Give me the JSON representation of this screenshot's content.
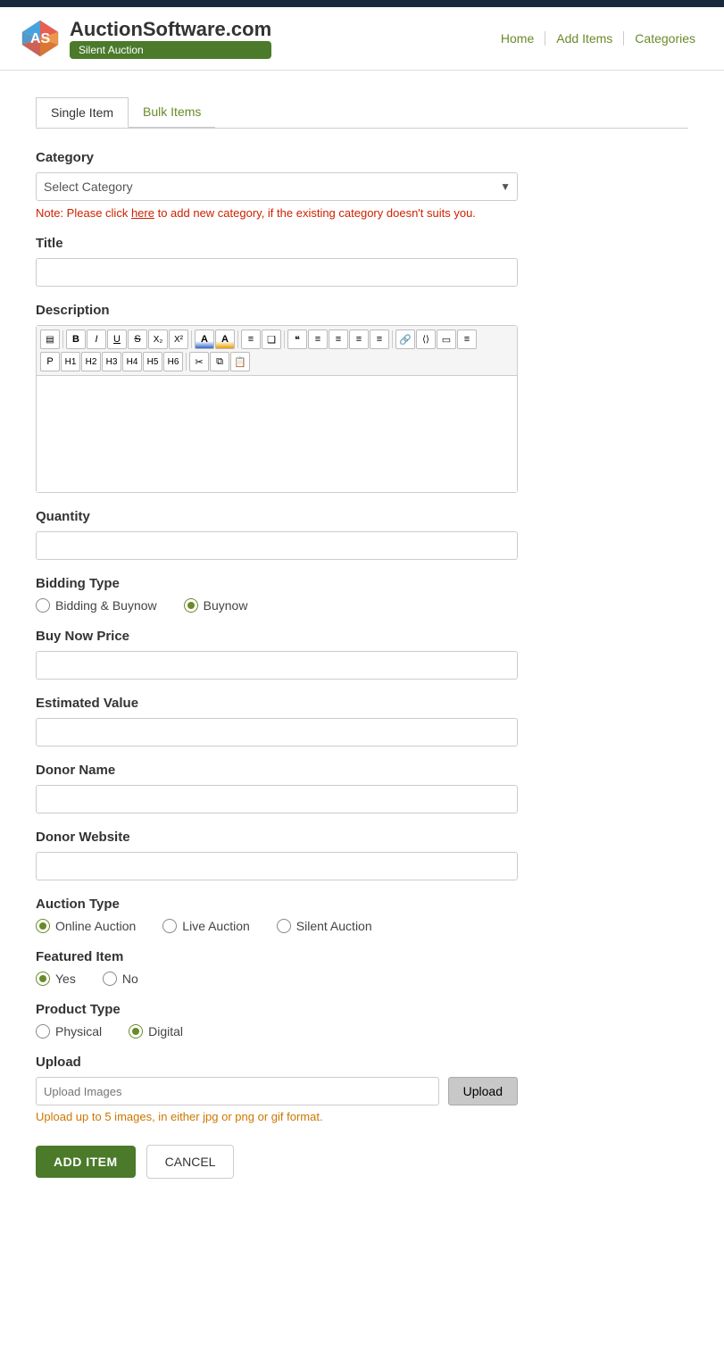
{
  "header": {
    "bar_color": "#1a2a3a"
  },
  "navbar": {
    "brand": "AuctionSoftware.com",
    "badge": "Silent Auction",
    "links": [
      "Home",
      "Add Items",
      "Categories"
    ]
  },
  "tabs": {
    "active": "Single Item",
    "inactive": "Bulk Items"
  },
  "form": {
    "category_label": "Category",
    "category_placeholder": "Select Category",
    "category_note_prefix": "Note: Please click ",
    "category_note_link": "here",
    "category_note_suffix": " to add new category, if the existing category doesn't suits you.",
    "title_label": "Title",
    "description_label": "Description",
    "quantity_label": "Quantity",
    "bidding_type_label": "Bidding Type",
    "bidding_type_options": [
      {
        "id": "bidding-buynow",
        "label": "Bidding & Buynow",
        "checked": false
      },
      {
        "id": "buynow",
        "label": "Buynow",
        "checked": true
      }
    ],
    "buy_now_price_label": "Buy Now Price",
    "estimated_value_label": "Estimated Value",
    "donor_name_label": "Donor Name",
    "donor_website_label": "Donor Website",
    "auction_type_label": "Auction Type",
    "auction_type_options": [
      {
        "id": "online-auction",
        "label": "Online Auction",
        "checked": true
      },
      {
        "id": "live-auction",
        "label": "Live Auction",
        "checked": false
      },
      {
        "id": "silent-auction",
        "label": "Silent Auction",
        "checked": false
      }
    ],
    "featured_item_label": "Featured Item",
    "featured_item_options": [
      {
        "id": "yes",
        "label": "Yes",
        "checked": true
      },
      {
        "id": "no",
        "label": "No",
        "checked": false
      }
    ],
    "product_type_label": "Product Type",
    "product_type_options": [
      {
        "id": "physical",
        "label": "Physical",
        "checked": false
      },
      {
        "id": "digital",
        "label": "Digital",
        "checked": true
      }
    ],
    "upload_label": "Upload",
    "upload_placeholder": "Upload Images",
    "upload_btn_label": "Upload",
    "upload_note": "Upload up to 5 images, in either jpg or png or gif format.",
    "add_item_btn": "ADD ITEM",
    "cancel_btn": "CANCEL"
  },
  "toolbar": {
    "row1_btns": [
      "▤",
      "B",
      "I",
      "U",
      "S",
      "X₂",
      "X²",
      "A",
      "A",
      "≡",
      "❑",
      "≡",
      "≡",
      "≡",
      "≡",
      "≡",
      "≡",
      "🔗",
      "⟨⟩",
      "▭",
      "≡"
    ],
    "row2_btns": [
      "P",
      "H1",
      "H2",
      "H3",
      "H4",
      "H5",
      "H6",
      "✂",
      "⧉",
      "📋"
    ]
  }
}
